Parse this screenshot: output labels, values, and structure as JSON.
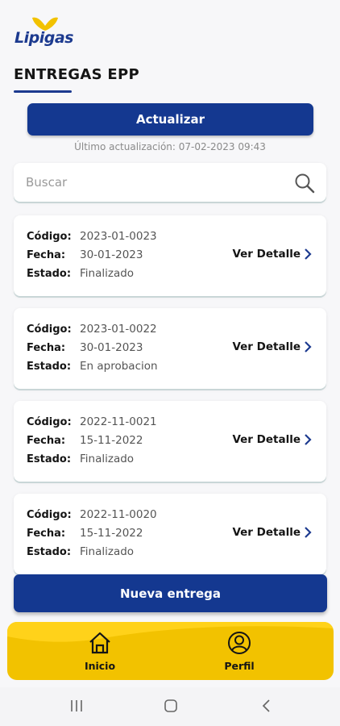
{
  "brand": {
    "name": "Lipigas",
    "primary": "#143890",
    "accent": "#f2c200"
  },
  "header": {
    "title": "ENTREGAS EPP"
  },
  "update": {
    "button_label": "Actualizar",
    "last_update": "Último actualización: 07-02-2023 09:43"
  },
  "search": {
    "placeholder": "Buscar",
    "icon": "search-icon"
  },
  "labels": {
    "code": "Código:",
    "date": "Fecha:",
    "status": "Estado:",
    "detail": "Ver Detalle"
  },
  "entregas": [
    {
      "codigo": "2023-01-0023",
      "fecha": "30-01-2023",
      "estado": "Finalizado"
    },
    {
      "codigo": "2023-01-0022",
      "fecha": "30-01-2023",
      "estado": "En aprobacion"
    },
    {
      "codigo": "2022-11-0021",
      "fecha": "15-11-2022",
      "estado": "Finalizado"
    },
    {
      "codigo": "2022-11-0020",
      "fecha": "15-11-2022",
      "estado": "Finalizado"
    }
  ],
  "new_button": {
    "label": "Nueva entrega"
  },
  "bottom_nav": [
    {
      "label": "Inicio",
      "icon": "home-icon"
    },
    {
      "label": "Perfil",
      "icon": "user-circle-icon"
    }
  ],
  "system_nav": {
    "icons": [
      "recent-apps-icon",
      "home-button-icon",
      "back-icon"
    ]
  }
}
